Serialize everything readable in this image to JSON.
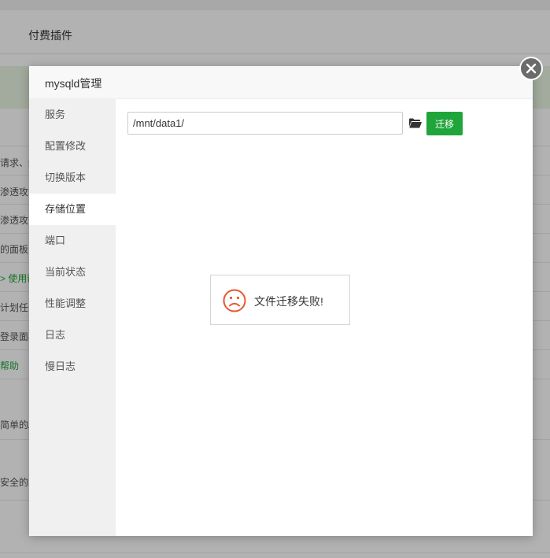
{
  "background": {
    "tab_label": "付费插件",
    "rows": [
      {
        "text": "请求、蛛"
      },
      {
        "text": "渗透攻击"
      },
      {
        "text": "渗透攻击"
      },
      {
        "text": "的面板，"
      },
      {
        "text": "> 使用帮"
      },
      {
        "text": "计划任务"
      },
      {
        "text": "登录面板"
      },
      {
        "text": "帮助"
      },
      {
        "text": "简单的A"
      },
      {
        "text": "安全的S"
      }
    ]
  },
  "modal": {
    "title": "mysqld管理",
    "close_icon": "close-icon"
  },
  "sidebar": {
    "items": [
      {
        "label": "服务"
      },
      {
        "label": "配置修改"
      },
      {
        "label": "切换版本"
      },
      {
        "label": "存储位置",
        "active": true
      },
      {
        "label": "端口"
      },
      {
        "label": "当前状态"
      },
      {
        "label": "性能调整"
      },
      {
        "label": "日志"
      },
      {
        "label": "慢日志"
      }
    ]
  },
  "storage": {
    "path_value": "/mnt/data1/",
    "folder_icon": "folder-open-icon",
    "migrate_label": "迁移"
  },
  "toast": {
    "icon": "sad-face-icon",
    "message": "文件迁移失败!"
  },
  "colors": {
    "accent": "#20a53a",
    "error": "#e8572f",
    "overlay": "rgba(0,0,0,0.30)"
  }
}
